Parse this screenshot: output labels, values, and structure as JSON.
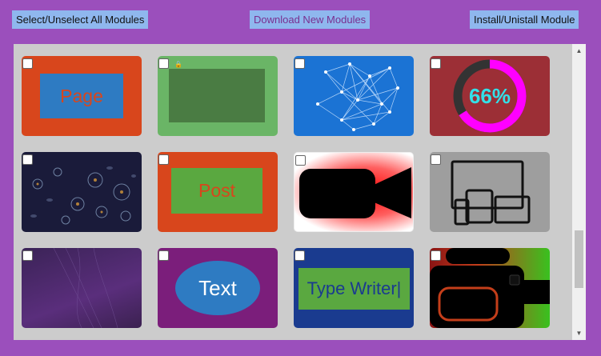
{
  "toolbar": {
    "select_all_label": "Select/Unselect All Modules",
    "download_label": "Download New Modules",
    "install_label": "Install/Unistall Module"
  },
  "modules": [
    {
      "name": "module-page",
      "label": "Page"
    },
    {
      "name": "module-green-box",
      "label": ""
    },
    {
      "name": "module-network",
      "label": ""
    },
    {
      "name": "module-progress-donut",
      "label": "66%",
      "progress": 0.66
    },
    {
      "name": "module-jellyfish",
      "label": ""
    },
    {
      "name": "module-post",
      "label": "Post"
    },
    {
      "name": "module-video",
      "label": ""
    },
    {
      "name": "module-devices",
      "label": ""
    },
    {
      "name": "module-purple-lines",
      "label": ""
    },
    {
      "name": "module-text",
      "label": "Text"
    },
    {
      "name": "module-type-writer",
      "label": "Type Writer|"
    },
    {
      "name": "module-video-camera",
      "label": ""
    }
  ],
  "colors": {
    "background": "#9b4fbc",
    "button": "#8fb7ee",
    "panel": "#cccccc"
  }
}
